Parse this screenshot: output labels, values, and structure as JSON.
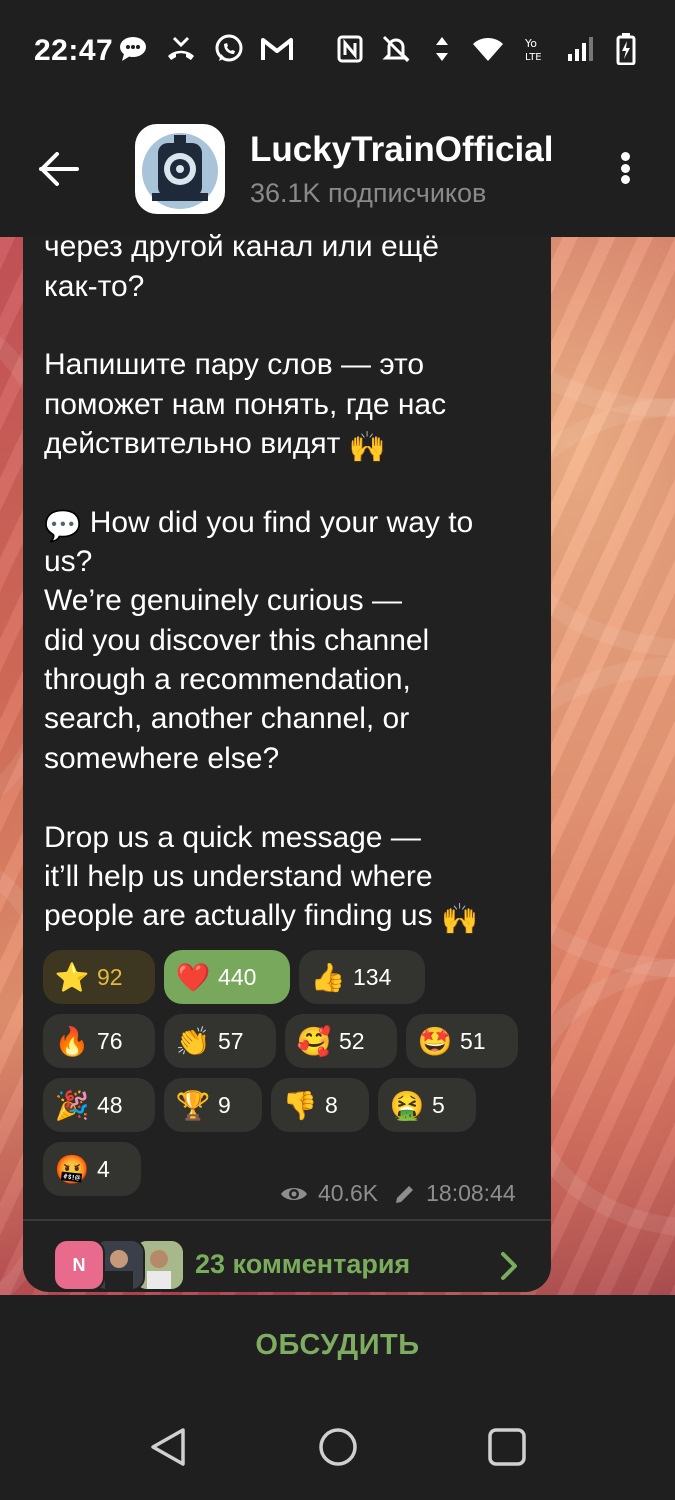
{
  "status_bar": {
    "time": "22:47"
  },
  "header": {
    "channel_name": "LuckyTrainOfficial",
    "subscribers": "36.1K подписчиков"
  },
  "message": {
    "lines": [
      "через другой канал или ещё",
      "как-то?",
      "",
      "Напишите пару слов — это",
      "поможет нам понять, где нас",
      "действительно видят",
      "",
      "How did you find your way to",
      "us?",
      "We’re genuinely curious —",
      "did you discover this channel",
      "through a recommendation,",
      "search, another channel, or",
      "somewhere else?",
      "",
      "Drop us a quick message —",
      "it’ll help us understand where",
      "people are actually finding us"
    ],
    "reactions": [
      {
        "emoji": "⭐",
        "icon": "star-icon",
        "count": "92"
      },
      {
        "emoji": "❤️",
        "icon": "heart-icon",
        "count": "440"
      },
      {
        "emoji": "👍",
        "icon": "thumbs-up-icon",
        "count": "134"
      },
      {
        "emoji": "🔥",
        "icon": "fire-icon",
        "count": "76"
      },
      {
        "emoji": "👏",
        "icon": "clap-icon",
        "count": "57"
      },
      {
        "emoji": "🥰",
        "icon": "smiling-hearts-icon",
        "count": "52"
      },
      {
        "emoji": "🤩",
        "icon": "star-struck-icon",
        "count": "51"
      },
      {
        "emoji": "🎉",
        "icon": "party-popper-icon",
        "count": "48"
      },
      {
        "emoji": "🏆",
        "icon": "trophy-icon",
        "count": "9"
      },
      {
        "emoji": "👎",
        "icon": "thumbs-down-icon",
        "count": "8"
      },
      {
        "emoji": "🤮",
        "icon": "vomit-icon",
        "count": "5"
      },
      {
        "emoji": "🤬",
        "icon": "cursing-face-icon",
        "count": "4"
      }
    ],
    "views": "40.6K",
    "time": "18:08:44"
  },
  "comments": {
    "avatar_letter": "N",
    "label": "23 комментария"
  },
  "discuss_button": "ОБСУДИТЬ",
  "colors": {
    "accent_green": "#79ad5b",
    "bubble_bg": "#212121",
    "heart_reaction_bg": "#78a85b",
    "star_reaction_text": "#e7b73d"
  }
}
